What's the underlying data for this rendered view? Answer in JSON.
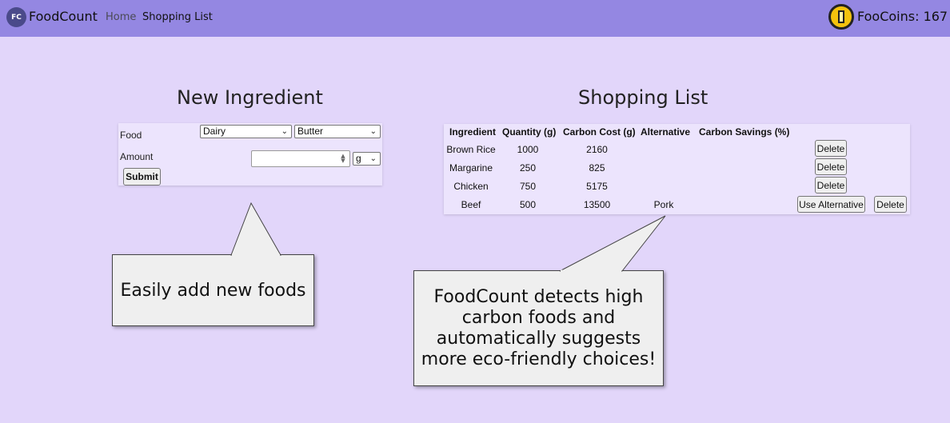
{
  "navbar": {
    "logo_text": "FC",
    "brand": "FoodCount",
    "links": [
      "Home",
      "Shopping List"
    ],
    "coins_label": "FooCoins: 167",
    "coin_icon": "coin-icon"
  },
  "new_ingredient": {
    "title": "New Ingredient",
    "food_label": "Food",
    "category_value": "Dairy",
    "item_value": "Butter",
    "amount_label": "Amount",
    "amount_value": "",
    "unit_value": "g",
    "submit_label": "Submit"
  },
  "shopping_list": {
    "title": "Shopping List",
    "columns": [
      "Ingredient",
      "Quantity (g)",
      "Carbon Cost (g)",
      "Alternative",
      "Carbon Savings (%)"
    ],
    "rows": [
      {
        "ingredient": "Brown Rice",
        "quantity": "1000",
        "carbon_cost": "2160",
        "alternative": "",
        "savings": "",
        "delete_label": "Delete"
      },
      {
        "ingredient": "Margarine",
        "quantity": "250",
        "carbon_cost": "825",
        "alternative": "",
        "savings": "",
        "delete_label": "Delete"
      },
      {
        "ingredient": "Chicken",
        "quantity": "750",
        "carbon_cost": "5175",
        "alternative": "",
        "savings": "",
        "delete_label": "Delete"
      },
      {
        "ingredient": "Beef",
        "quantity": "500",
        "carbon_cost": "13500",
        "alternative": "Pork",
        "savings": "",
        "use_alt_label": "Use Alternative",
        "delete_label": "Delete"
      }
    ]
  },
  "callouts": {
    "add": "Easily add new foods",
    "detect": "FoodCount detects high carbon foods and automatically suggests more eco-friendly choices!"
  }
}
